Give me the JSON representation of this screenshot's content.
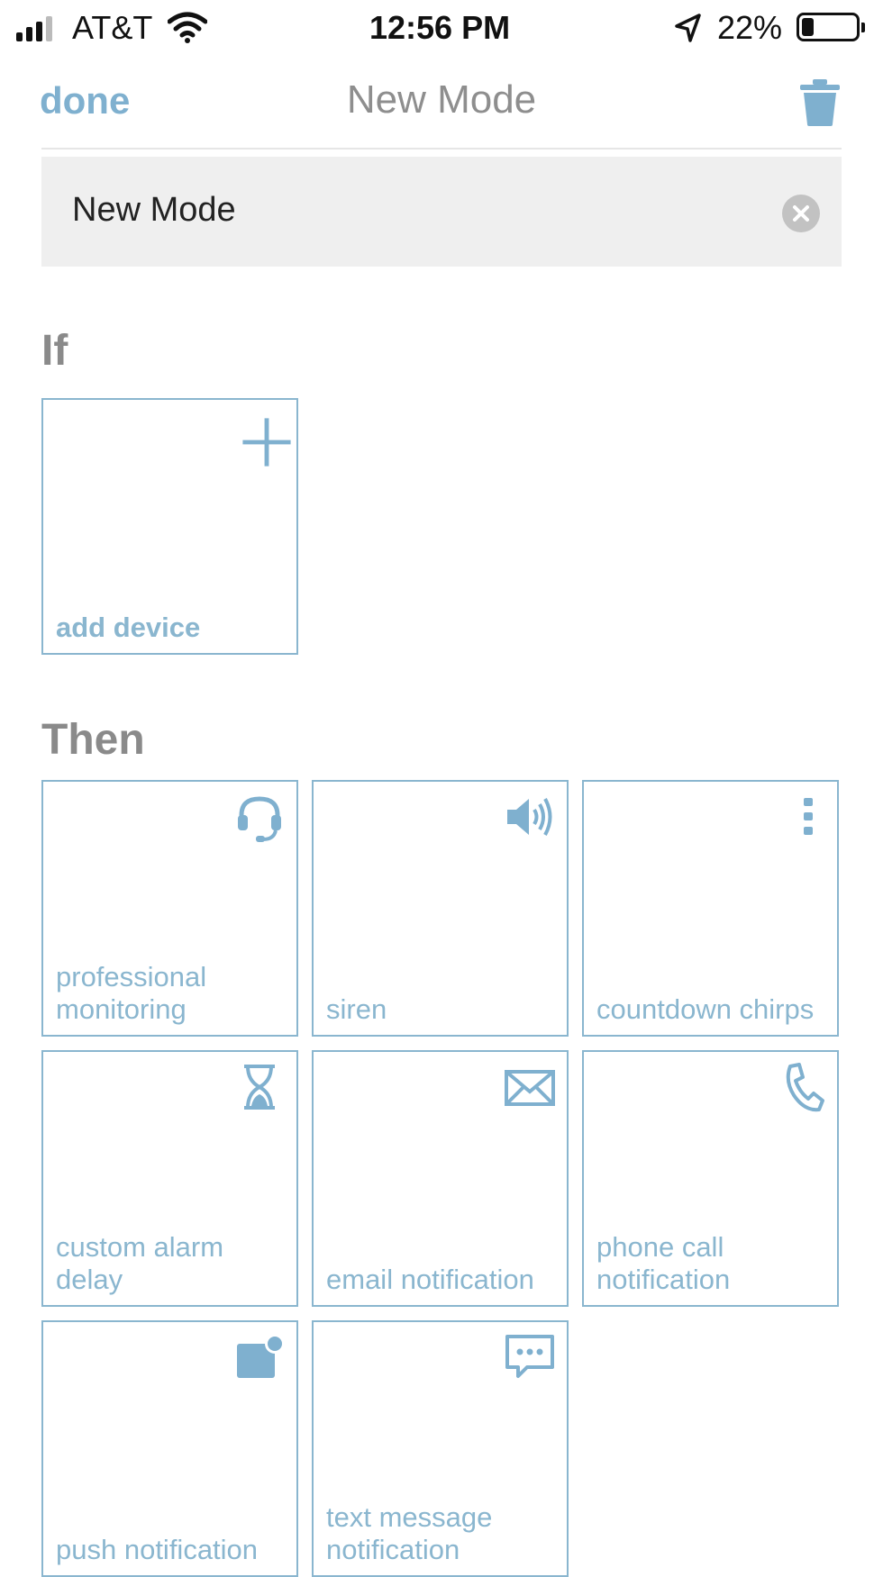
{
  "status_bar": {
    "carrier": "AT&T",
    "time": "12:56 PM",
    "battery_percent": "22%",
    "battery_level": 0.22
  },
  "nav": {
    "done_label": "done",
    "title": "New Mode",
    "trash_icon": "trash-icon"
  },
  "name_field": {
    "value": "New Mode",
    "clear_icon": "clear-circle-icon"
  },
  "if_section": {
    "title": "If",
    "add_device": {
      "label": "add device",
      "icon": "plus-icon"
    }
  },
  "then_section": {
    "title": "Then",
    "tiles": [
      {
        "label": "professional monitoring",
        "icon": "headset-icon"
      },
      {
        "label": "siren",
        "icon": "speaker-icon"
      },
      {
        "label": "countdown chirps",
        "icon": "dots-vertical-icon"
      },
      {
        "label": "custom alarm delay",
        "icon": "hourglass-icon"
      },
      {
        "label": "email notification",
        "icon": "envelope-icon"
      },
      {
        "label": "phone call notification",
        "icon": "phone-icon"
      },
      {
        "label": "push notification",
        "icon": "push-badge-icon"
      },
      {
        "label": "text message notification",
        "icon": "chat-bubble-icon"
      }
    ]
  },
  "colors": {
    "accent": "#7fb0cf",
    "tile_border": "#8ab6cf",
    "section_title": "#8a8a8a",
    "field_bg": "#efefef"
  }
}
